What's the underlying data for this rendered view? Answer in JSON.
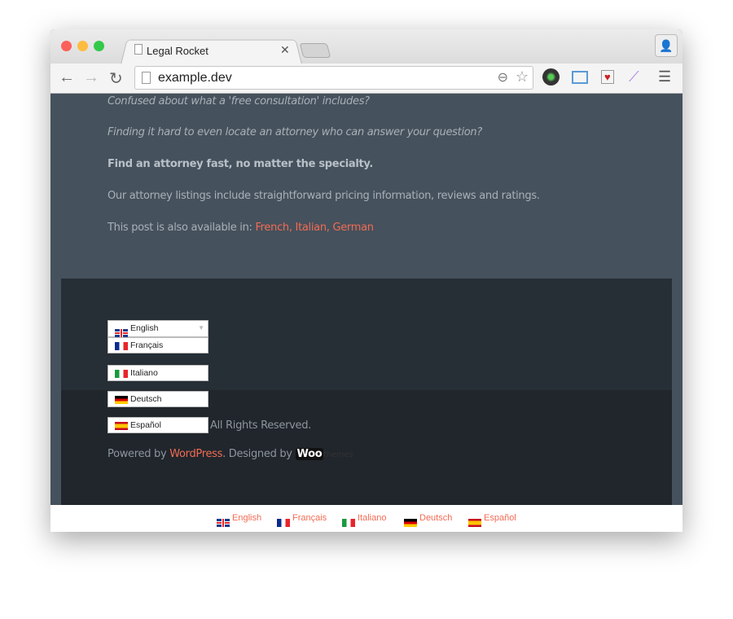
{
  "browser": {
    "tab_title": "Legal Rocket",
    "url": "example.dev"
  },
  "content": {
    "p1": "Confused about what a 'free consultation' includes?",
    "p2": "Finding it hard to even locate an attorney who can answer your question?",
    "p3": "Find an attorney fast, no matter the specialty.",
    "p4": "Our attorney listings include straightforward pricing information, reviews and ratings.",
    "p5_prefix": "This post is also available in: ",
    "p5_links": [
      "French",
      "Italian",
      "German"
    ]
  },
  "footer": {
    "languages": [
      "English",
      "Français",
      "Italiano",
      "Deutsch",
      "Español"
    ],
    "rights": "All Rights Reserved.",
    "powered_prefix": "Powered by ",
    "wordpress": "WordPress",
    ". designed": ". Designed by ",
    "designed": ". Designed by ",
    "woo": "Woo",
    "themes": "themes"
  },
  "bottom_languages": [
    "English",
    "Français",
    "Italiano",
    "Deutsch",
    "Español"
  ],
  "colors": {
    "accent": "#f36b54",
    "content_bg": "#45515c",
    "footer_bg": "#20262c"
  }
}
